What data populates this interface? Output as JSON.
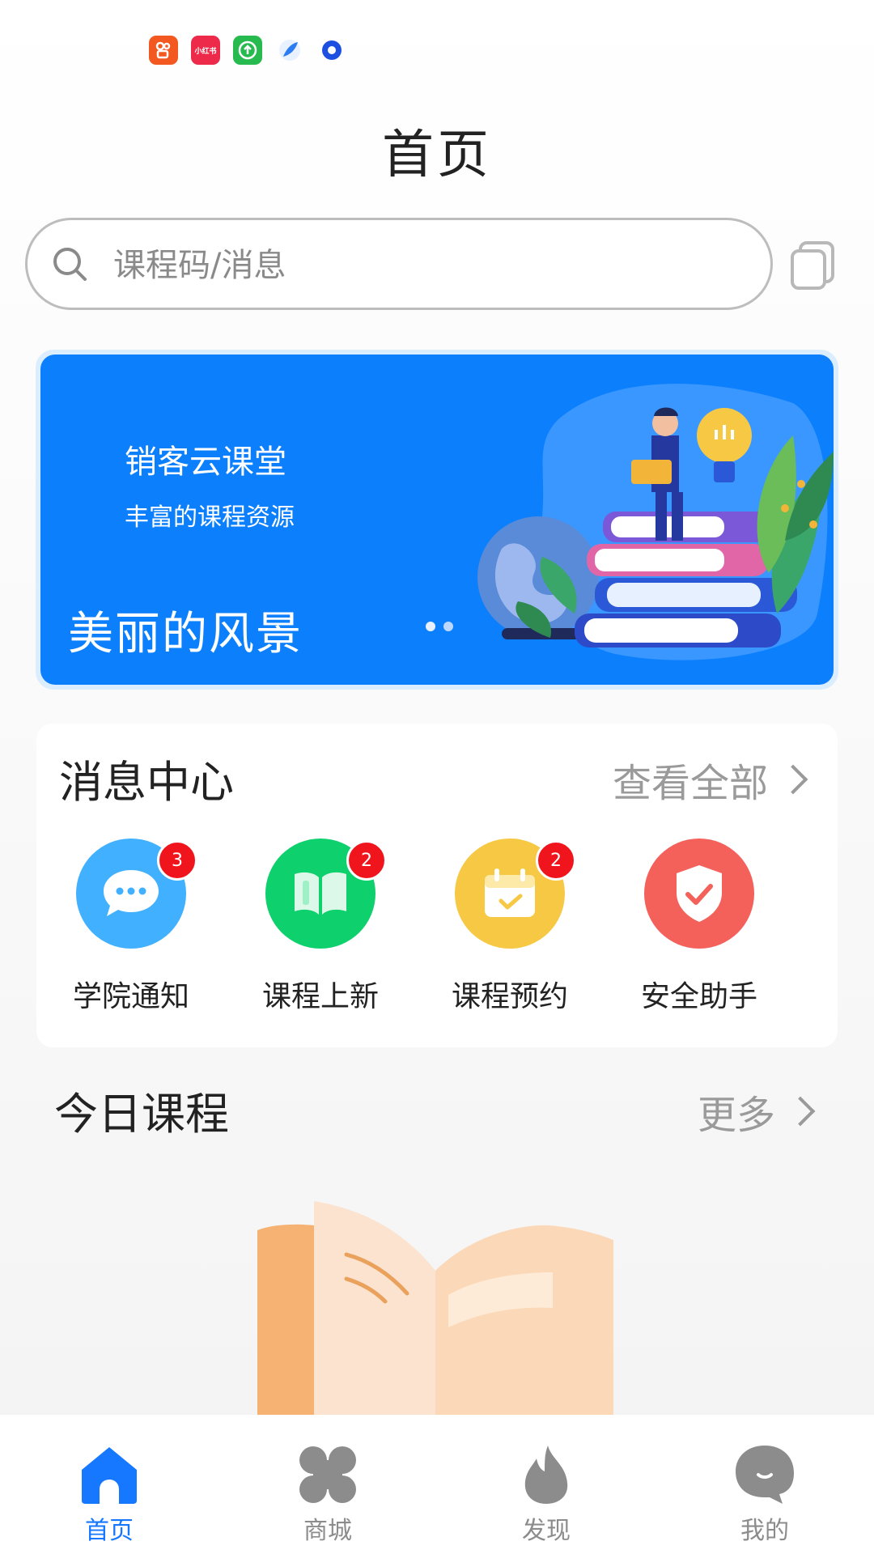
{
  "status_bar": {
    "icons": [
      "kuaishou-app-icon",
      "xiaohongshu-app-icon",
      "upload-app-icon",
      "feather-app-icon",
      "ring-app-icon"
    ],
    "xiaohongshu_text": "小红书"
  },
  "header": {
    "title": "首页"
  },
  "search": {
    "placeholder": "课程码/消息"
  },
  "banner": {
    "title": "销客云课堂",
    "subtitle": "丰富的课程资源",
    "caption": "美丽的风景",
    "page_count": 2,
    "active_page": 1,
    "color": "#0c7ffd"
  },
  "message_center": {
    "title": "消息中心",
    "more_label": "查看全部",
    "items": [
      {
        "label": "学院通知",
        "badge": "3",
        "icon": "chat-bubble-icon",
        "color": "#40b0ff"
      },
      {
        "label": "课程上新",
        "badge": "2",
        "icon": "open-book-icon",
        "color": "#0ed06c"
      },
      {
        "label": "课程预约",
        "badge": "2",
        "icon": "calendar-check-icon",
        "color": "#f7c843"
      },
      {
        "label": "安全助手",
        "badge": "",
        "icon": "shield-check-icon",
        "color": "#f4605a"
      }
    ]
  },
  "today_courses": {
    "title": "今日课程",
    "more_label": "更多"
  },
  "tab_bar": {
    "active_color": "#1677ff",
    "inactive_color": "#8c8c8c",
    "tabs": [
      {
        "label": "首页",
        "icon": "home-icon",
        "active": true
      },
      {
        "label": "商城",
        "icon": "clover-icon",
        "active": false
      },
      {
        "label": "发现",
        "icon": "flame-icon",
        "active": false
      },
      {
        "label": "我的",
        "icon": "smile-face-icon",
        "active": false
      }
    ]
  }
}
